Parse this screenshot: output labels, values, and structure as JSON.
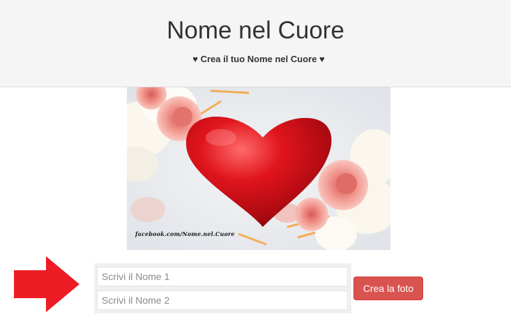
{
  "header": {
    "title": "Nome nel Cuore",
    "subtitle": "♥ Crea il tuo Nome nel Cuore ♥"
  },
  "photo": {
    "watermark": "facebook.com/Nome.nel.Cuore",
    "icon": "red-heart-with-flowers"
  },
  "form": {
    "name1_placeholder": "Scrivi il Nome 1",
    "name2_placeholder": "Scrivi il Nome 2",
    "submit_label": "Crea la foto"
  },
  "colors": {
    "header_bg": "#f5f5f5",
    "button_bg": "#d9534f",
    "arrow": "#ee1c25",
    "heart": "#c8101a"
  }
}
